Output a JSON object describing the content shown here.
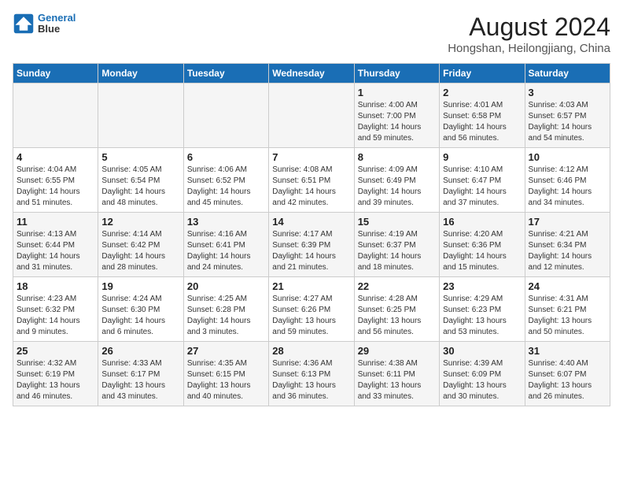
{
  "header": {
    "logo_line1": "General",
    "logo_line2": "Blue",
    "title": "August 2024",
    "subtitle": "Hongshan, Heilongjiang, China"
  },
  "days_of_week": [
    "Sunday",
    "Monday",
    "Tuesday",
    "Wednesday",
    "Thursday",
    "Friday",
    "Saturday"
  ],
  "weeks": [
    [
      {
        "day": "",
        "sunrise": "",
        "sunset": "",
        "daylight": ""
      },
      {
        "day": "",
        "sunrise": "",
        "sunset": "",
        "daylight": ""
      },
      {
        "day": "",
        "sunrise": "",
        "sunset": "",
        "daylight": ""
      },
      {
        "day": "",
        "sunrise": "",
        "sunset": "",
        "daylight": ""
      },
      {
        "day": "1",
        "sunrise": "Sunrise: 4:00 AM",
        "sunset": "Sunset: 7:00 PM",
        "daylight": "Daylight: 14 hours and 59 minutes."
      },
      {
        "day": "2",
        "sunrise": "Sunrise: 4:01 AM",
        "sunset": "Sunset: 6:58 PM",
        "daylight": "Daylight: 14 hours and 56 minutes."
      },
      {
        "day": "3",
        "sunrise": "Sunrise: 4:03 AM",
        "sunset": "Sunset: 6:57 PM",
        "daylight": "Daylight: 14 hours and 54 minutes."
      }
    ],
    [
      {
        "day": "4",
        "sunrise": "Sunrise: 4:04 AM",
        "sunset": "Sunset: 6:55 PM",
        "daylight": "Daylight: 14 hours and 51 minutes."
      },
      {
        "day": "5",
        "sunrise": "Sunrise: 4:05 AM",
        "sunset": "Sunset: 6:54 PM",
        "daylight": "Daylight: 14 hours and 48 minutes."
      },
      {
        "day": "6",
        "sunrise": "Sunrise: 4:06 AM",
        "sunset": "Sunset: 6:52 PM",
        "daylight": "Daylight: 14 hours and 45 minutes."
      },
      {
        "day": "7",
        "sunrise": "Sunrise: 4:08 AM",
        "sunset": "Sunset: 6:51 PM",
        "daylight": "Daylight: 14 hours and 42 minutes."
      },
      {
        "day": "8",
        "sunrise": "Sunrise: 4:09 AM",
        "sunset": "Sunset: 6:49 PM",
        "daylight": "Daylight: 14 hours and 39 minutes."
      },
      {
        "day": "9",
        "sunrise": "Sunrise: 4:10 AM",
        "sunset": "Sunset: 6:47 PM",
        "daylight": "Daylight: 14 hours and 37 minutes."
      },
      {
        "day": "10",
        "sunrise": "Sunrise: 4:12 AM",
        "sunset": "Sunset: 6:46 PM",
        "daylight": "Daylight: 14 hours and 34 minutes."
      }
    ],
    [
      {
        "day": "11",
        "sunrise": "Sunrise: 4:13 AM",
        "sunset": "Sunset: 6:44 PM",
        "daylight": "Daylight: 14 hours and 31 minutes."
      },
      {
        "day": "12",
        "sunrise": "Sunrise: 4:14 AM",
        "sunset": "Sunset: 6:42 PM",
        "daylight": "Daylight: 14 hours and 28 minutes."
      },
      {
        "day": "13",
        "sunrise": "Sunrise: 4:16 AM",
        "sunset": "Sunset: 6:41 PM",
        "daylight": "Daylight: 14 hours and 24 minutes."
      },
      {
        "day": "14",
        "sunrise": "Sunrise: 4:17 AM",
        "sunset": "Sunset: 6:39 PM",
        "daylight": "Daylight: 14 hours and 21 minutes."
      },
      {
        "day": "15",
        "sunrise": "Sunrise: 4:19 AM",
        "sunset": "Sunset: 6:37 PM",
        "daylight": "Daylight: 14 hours and 18 minutes."
      },
      {
        "day": "16",
        "sunrise": "Sunrise: 4:20 AM",
        "sunset": "Sunset: 6:36 PM",
        "daylight": "Daylight: 14 hours and 15 minutes."
      },
      {
        "day": "17",
        "sunrise": "Sunrise: 4:21 AM",
        "sunset": "Sunset: 6:34 PM",
        "daylight": "Daylight: 14 hours and 12 minutes."
      }
    ],
    [
      {
        "day": "18",
        "sunrise": "Sunrise: 4:23 AM",
        "sunset": "Sunset: 6:32 PM",
        "daylight": "Daylight: 14 hours and 9 minutes."
      },
      {
        "day": "19",
        "sunrise": "Sunrise: 4:24 AM",
        "sunset": "Sunset: 6:30 PM",
        "daylight": "Daylight: 14 hours and 6 minutes."
      },
      {
        "day": "20",
        "sunrise": "Sunrise: 4:25 AM",
        "sunset": "Sunset: 6:28 PM",
        "daylight": "Daylight: 14 hours and 3 minutes."
      },
      {
        "day": "21",
        "sunrise": "Sunrise: 4:27 AM",
        "sunset": "Sunset: 6:26 PM",
        "daylight": "Daylight: 13 hours and 59 minutes."
      },
      {
        "day": "22",
        "sunrise": "Sunrise: 4:28 AM",
        "sunset": "Sunset: 6:25 PM",
        "daylight": "Daylight: 13 hours and 56 minutes."
      },
      {
        "day": "23",
        "sunrise": "Sunrise: 4:29 AM",
        "sunset": "Sunset: 6:23 PM",
        "daylight": "Daylight: 13 hours and 53 minutes."
      },
      {
        "day": "24",
        "sunrise": "Sunrise: 4:31 AM",
        "sunset": "Sunset: 6:21 PM",
        "daylight": "Daylight: 13 hours and 50 minutes."
      }
    ],
    [
      {
        "day": "25",
        "sunrise": "Sunrise: 4:32 AM",
        "sunset": "Sunset: 6:19 PM",
        "daylight": "Daylight: 13 hours and 46 minutes."
      },
      {
        "day": "26",
        "sunrise": "Sunrise: 4:33 AM",
        "sunset": "Sunset: 6:17 PM",
        "daylight": "Daylight: 13 hours and 43 minutes."
      },
      {
        "day": "27",
        "sunrise": "Sunrise: 4:35 AM",
        "sunset": "Sunset: 6:15 PM",
        "daylight": "Daylight: 13 hours and 40 minutes."
      },
      {
        "day": "28",
        "sunrise": "Sunrise: 4:36 AM",
        "sunset": "Sunset: 6:13 PM",
        "daylight": "Daylight: 13 hours and 36 minutes."
      },
      {
        "day": "29",
        "sunrise": "Sunrise: 4:38 AM",
        "sunset": "Sunset: 6:11 PM",
        "daylight": "Daylight: 13 hours and 33 minutes."
      },
      {
        "day": "30",
        "sunrise": "Sunrise: 4:39 AM",
        "sunset": "Sunset: 6:09 PM",
        "daylight": "Daylight: 13 hours and 30 minutes."
      },
      {
        "day": "31",
        "sunrise": "Sunrise: 4:40 AM",
        "sunset": "Sunset: 6:07 PM",
        "daylight": "Daylight: 13 hours and 26 minutes."
      }
    ]
  ]
}
